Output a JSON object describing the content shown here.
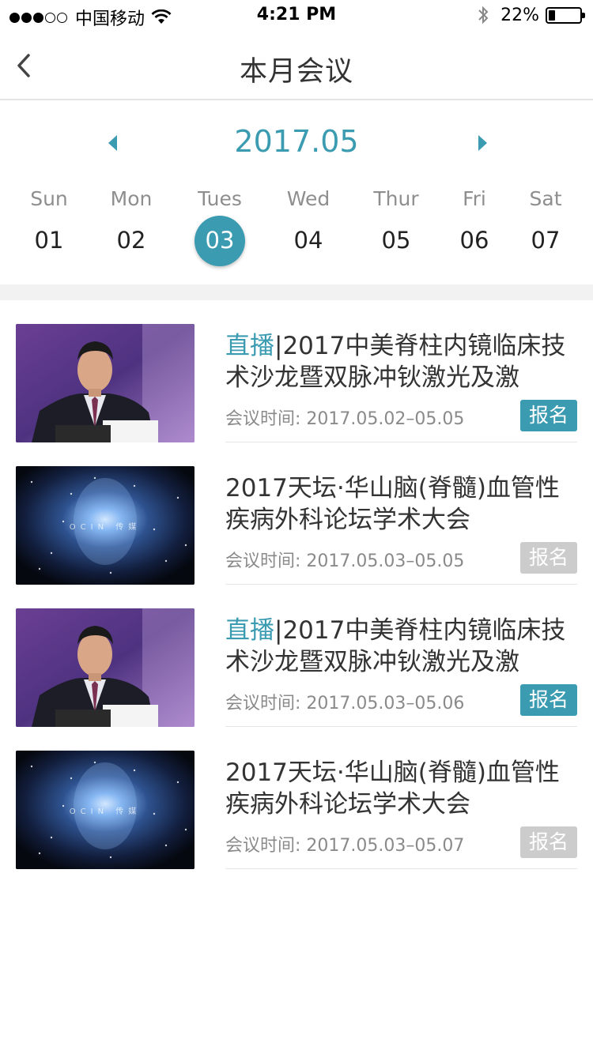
{
  "status_bar": {
    "carrier": "中国移动",
    "time": "4:21 PM",
    "battery_percent": "22%",
    "battery_level": 0.22,
    "signal_dots": [
      true,
      true,
      true,
      false,
      false
    ]
  },
  "nav": {
    "title": "本月会议",
    "back_icon": "chevron-left-icon"
  },
  "calendar": {
    "month": "2017.05",
    "weekdays": [
      "Sun",
      "Mon",
      "Tues",
      "Wed",
      "Thur",
      "Fri",
      "Sat"
    ],
    "days": [
      "01",
      "02",
      "03",
      "04",
      "05",
      "06",
      "07"
    ],
    "selected_index": 2,
    "accent_color": "#3a9bb1"
  },
  "meetings": [
    {
      "live_tag": "直播",
      "title": "|2017中美脊柱内镜临床技术沙龙暨双脉冲钬激光及激",
      "time": "会议时间: 2017.05.02–05.05",
      "signup": "报名",
      "signup_state": "active",
      "thumb": "speaker"
    },
    {
      "live_tag": "",
      "title": "2017天坛·华山脑(脊髓)血管性疾病外科论坛学术大会",
      "time": "会议时间: 2017.05.03–05.05",
      "signup": "报名",
      "signup_state": "disabled",
      "thumb": "space"
    },
    {
      "live_tag": "直播",
      "title": "|2017中美脊柱内镜临床技术沙龙暨双脉冲钬激光及激",
      "time": "会议时间: 2017.05.03–05.06",
      "signup": "报名",
      "signup_state": "active",
      "thumb": "speaker"
    },
    {
      "live_tag": "",
      "title": "2017天坛·华山脑(脊髓)血管性疾病外科论坛学术大会",
      "time": "会议时间: 2017.05.03–05.07",
      "signup": "报名",
      "signup_state": "disabled",
      "thumb": "space"
    }
  ]
}
